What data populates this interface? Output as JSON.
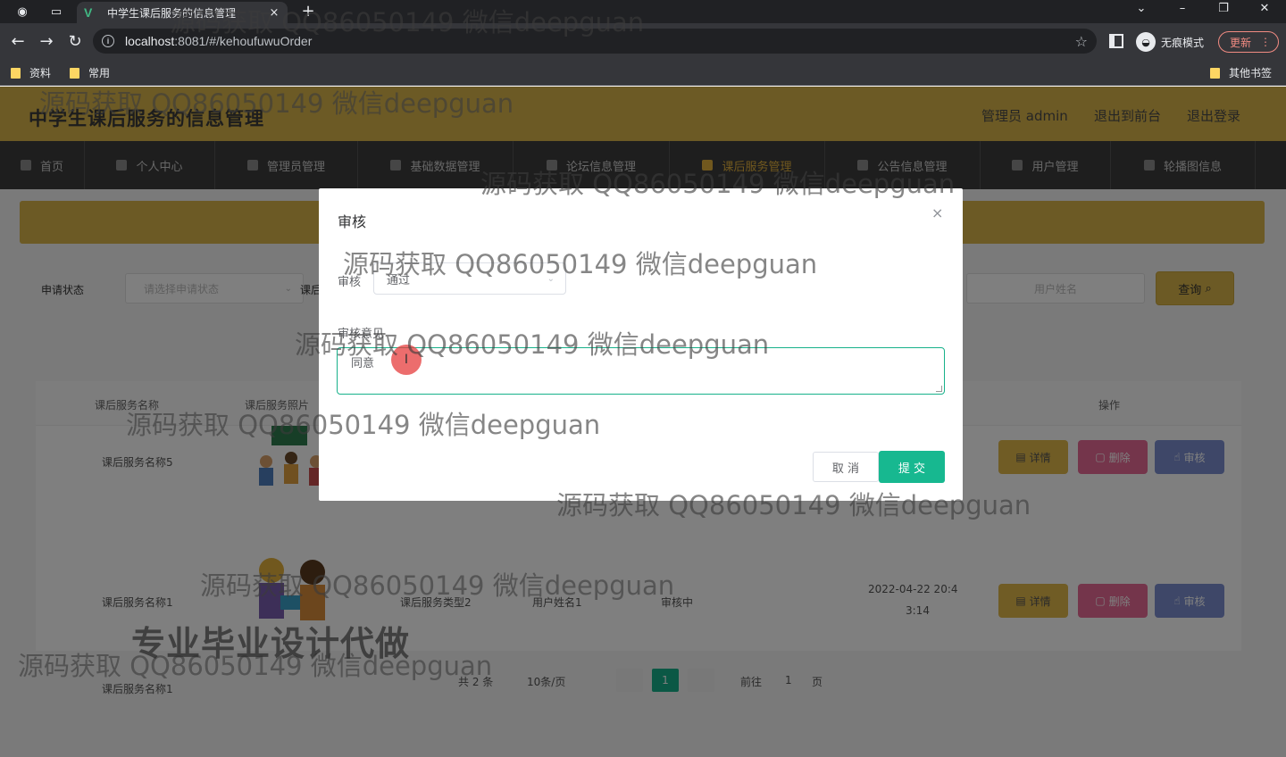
{
  "browser": {
    "tab_title": "中学生课后服务的信息管理",
    "tab_close": "×",
    "new_tab": "+",
    "url_host": "localhost",
    "url_rest": ":8081/#/kehoufuwuOrder",
    "incognito_label": "无痕模式",
    "update_label": "更新",
    "bookmarks": [
      "资料",
      "常用"
    ],
    "other_bookmarks": "其他书签",
    "icons": [
      "back-arrow-icon",
      "forward-arrow-icon",
      "reload-icon",
      "info-icon",
      "star-icon",
      "side-panel-icon",
      "incognito-icon",
      "menu-dots-icon"
    ]
  },
  "app": {
    "title": "中学生课后服务的信息管理",
    "header_links": [
      "管理员 admin",
      "退出到前台",
      "退出登录"
    ],
    "nav": [
      "首页",
      "个人中心",
      "管理员管理",
      "基础数据管理",
      "论坛信息管理",
      "课后服务管理",
      "公告信息管理",
      "用户管理",
      "轮播图信息"
    ],
    "active_nav": "课后服务管理",
    "accent_color": "#d9b44a",
    "primary_color": "#17b18a",
    "search": {
      "status_label": "申请状态",
      "status_placeholder": "请选择申请状态",
      "field2_label": "课后",
      "user_placeholder": "用户姓名",
      "query_button": "查询"
    },
    "table": {
      "headers": [
        "课后服务名称",
        "课后服务照片",
        "操作"
      ],
      "rows": [
        {
          "name": "课后服务名称5",
          "type": "",
          "user": "",
          "status": "",
          "time": ""
        },
        {
          "name": "课后服务名称1",
          "type": "课后服务类型2",
          "user": "用户姓名1",
          "status": "审核中",
          "time": "2022-04-22 20:4",
          "time2": "3:14"
        }
      ],
      "actions": {
        "detail": "详情",
        "delete": "删除",
        "audit": "审核"
      }
    },
    "pagination": {
      "total": "共 2 条",
      "page_size": "10条/页",
      "current_page": "1",
      "goto_label": "前往",
      "goto_value": "1",
      "page_suffix": "页"
    }
  },
  "dialog": {
    "title": "审核",
    "close": "×",
    "field_audit_label": "审核",
    "field_audit_value": "通过",
    "field_opinion_label": "审核意见",
    "field_opinion_value": "同意",
    "cancel_label": "取 消",
    "submit_label": "提 交"
  },
  "watermark": {
    "text": "源码获取 QQ86050149 微信deepguan",
    "slogan": "专业毕业设计代做"
  }
}
